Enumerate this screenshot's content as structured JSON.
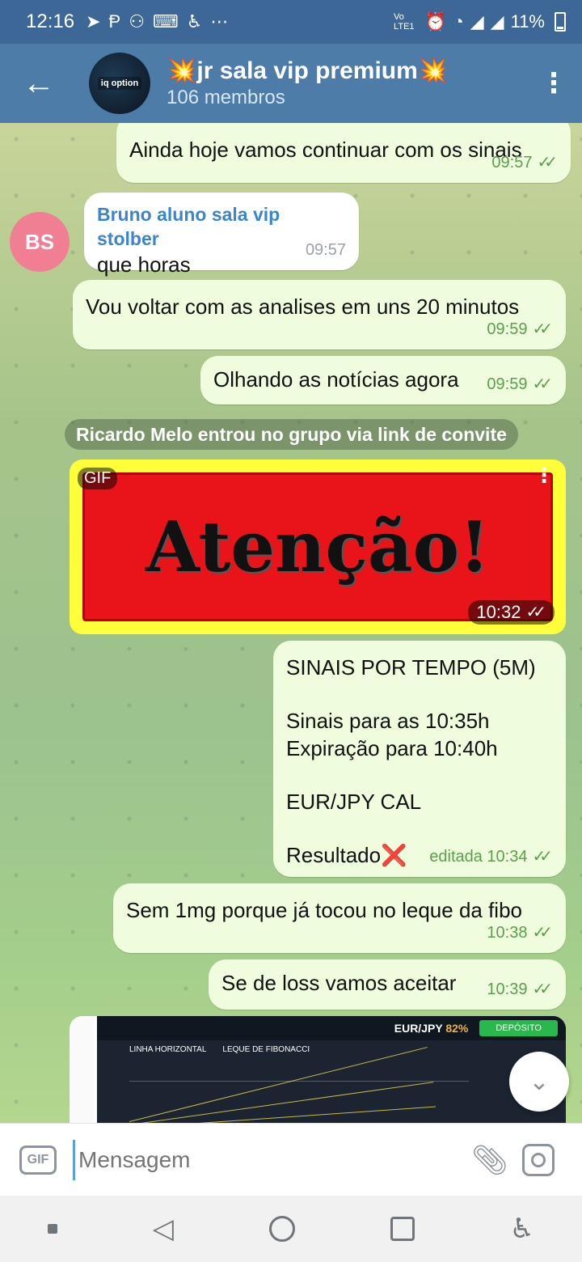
{
  "status": {
    "time": "12:16",
    "battery": "11%",
    "net": "Vo LTE1"
  },
  "header": {
    "title": "💥jr sala vip premium💥",
    "subtitle": "106 membros",
    "avatar_logo": "iq option"
  },
  "messages": {
    "m1": {
      "text": "Ainda hoje vamos continuar com os sinais",
      "time": "09:57"
    },
    "m2": {
      "sender": "Bruno aluno sala vip stolber",
      "text": "que horas",
      "time": "09:57",
      "avatar": "BS"
    },
    "m3": {
      "text": "Vou voltar com as analises em uns 20 minutos",
      "time": "09:59"
    },
    "m4": {
      "text": "Olhando as notícias agora",
      "time": "09:59"
    },
    "service": "Ricardo Melo entrou no grupo via link de convite",
    "gif": {
      "badge": "GIF",
      "text": "Atenção!",
      "time": "10:32"
    },
    "signal": {
      "line1": "SINAIS POR TEMPO (5M)",
      "line2": "Sinais para as 10:35h",
      "line3": "Expiração para 10:40h",
      "line4": "EUR/JPY CAL",
      "line5": "Resultado❌",
      "time": "editada 10:34"
    },
    "m6": {
      "text": "Sem 1mg porque já tocou no leque da fibo",
      "time": "10:38"
    },
    "m7": {
      "text": "Se de loss vamos aceitar",
      "time": "10:39"
    },
    "screenshot": {
      "pair": "EUR/JPY",
      "pct": "82%",
      "deposit": "DEPÓSITO",
      "tool1": "LINHA HORIZONTAL",
      "tool2": "LEQUE DE FIBONACCI"
    }
  },
  "composer": {
    "gif_label": "GIF",
    "placeholder": "Mensagem"
  },
  "icons": {
    "back": "arrow-left",
    "more": "vertical-dots",
    "attach": "paperclip",
    "camera": "camera",
    "scroll_down": "chevron-down"
  }
}
